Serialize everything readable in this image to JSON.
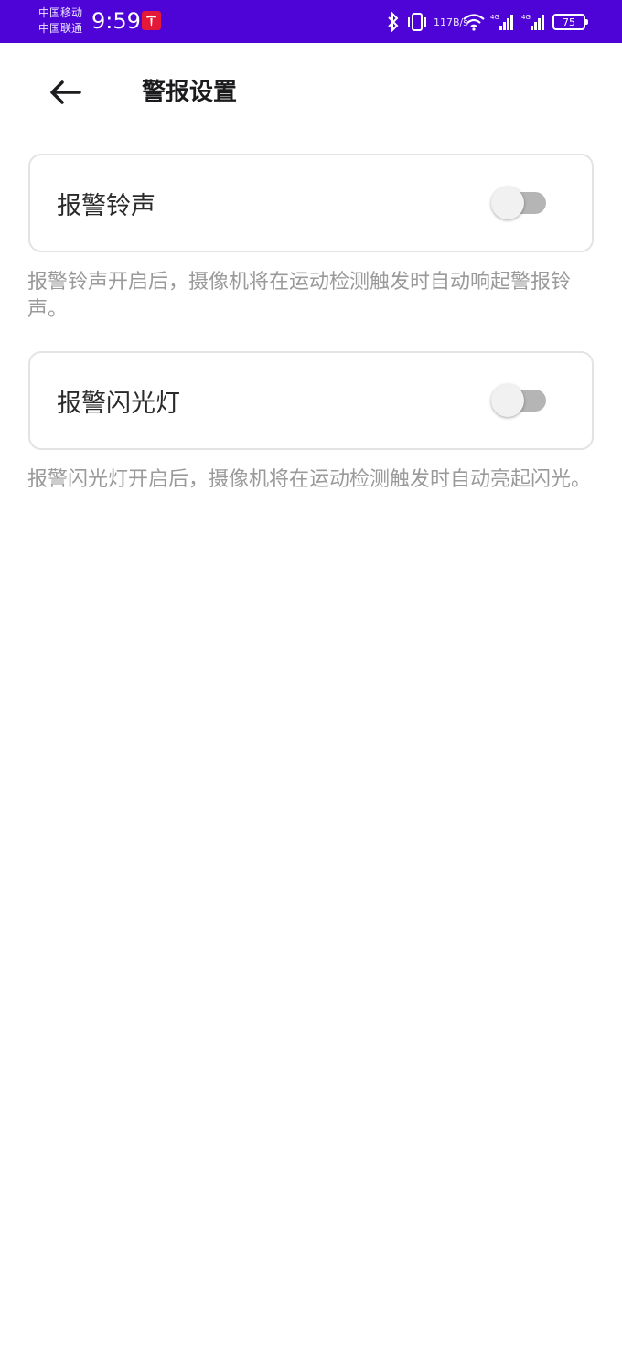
{
  "status_bar": {
    "carrier_1": "中国移动",
    "carrier_2": "中国联通",
    "time": "9:59",
    "net_speed_value": "117",
    "net_speed_unit": "B/s",
    "battery_level": "75",
    "bg_color": "#4e04d6"
  },
  "header": {
    "back_icon": "arrow-left-icon",
    "title": "警报设置"
  },
  "settings": [
    {
      "label": "报警铃声",
      "enabled": false,
      "hint": "报警铃声开启后，摄像机将在运动检测触发时自动响起警报铃声。"
    },
    {
      "label": "报警闪光灯",
      "enabled": false,
      "hint": "报警闪光灯开启后，摄像机将在运动检测触发时自动亮起闪光。"
    }
  ]
}
